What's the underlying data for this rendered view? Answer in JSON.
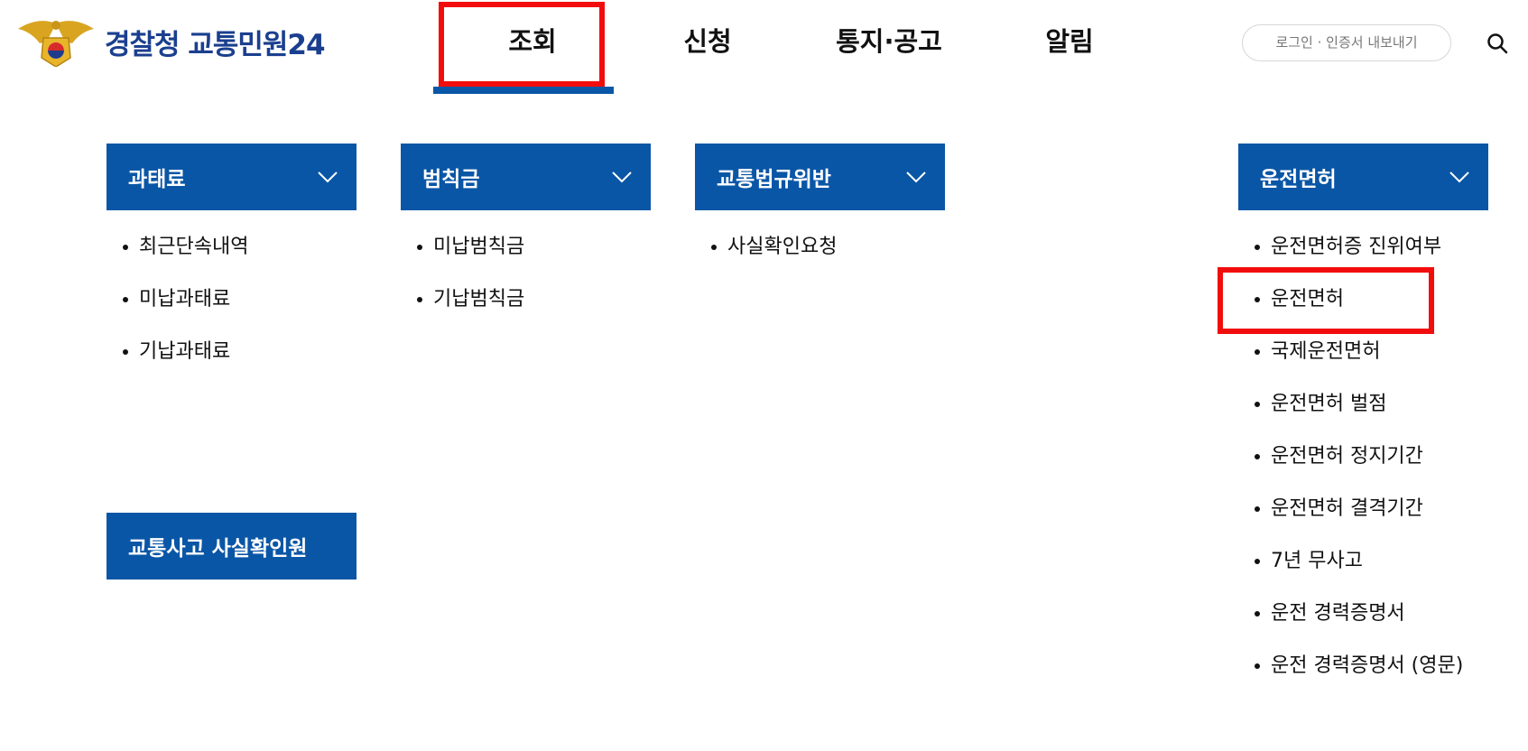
{
  "header": {
    "logo_text": "경찰청 교통민원24",
    "nav": [
      "조회",
      "신청",
      "통지·공고",
      "알림"
    ],
    "login_label": "로그인 · 인증서 내보내기"
  },
  "menu": {
    "categories": [
      {
        "title": "과태료",
        "items": [
          "최근단속내역",
          "미납과태료",
          "기납과태료"
        ]
      },
      {
        "title": "범칙금",
        "items": [
          "미납범칙금",
          "기납범칙금"
        ]
      },
      {
        "title": "교통법규위반",
        "items": [
          "사실확인요청"
        ]
      },
      {
        "title": "운전면허",
        "items": [
          "운전면허증 진위여부",
          "운전면허",
          "국제운전면허",
          "운전면허 벌점",
          "운전면허 정지기간",
          "운전면허 결격기간",
          "7년 무사고",
          "운전 경력증명서",
          "운전 경력증명서 (영문)"
        ]
      }
    ],
    "accident_title": "교통사고 사실확인원"
  },
  "colors": {
    "accent": "#0a56a6",
    "highlight": "#f20d0d",
    "logo": "#1b3f8f"
  }
}
